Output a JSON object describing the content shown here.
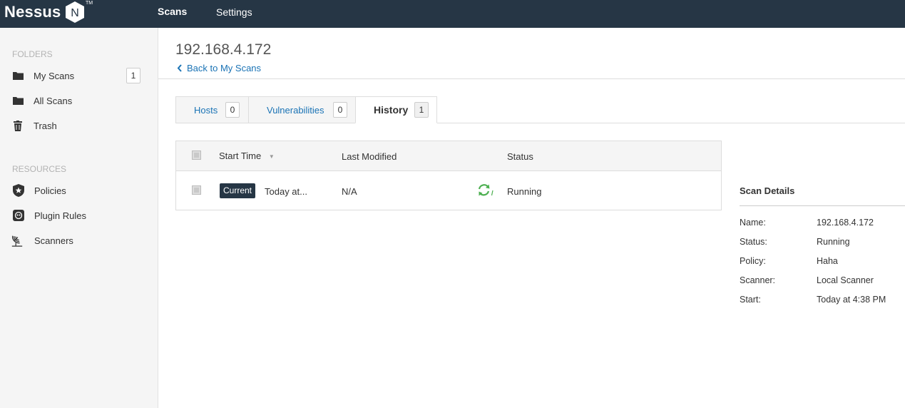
{
  "app": {
    "logo_text": "Nessus",
    "logo_badge_letter": "N",
    "trademark": "TM",
    "nav": [
      {
        "label": "Scans",
        "active": true
      },
      {
        "label": "Settings",
        "active": false
      }
    ]
  },
  "sidebar": {
    "folders_title": "FOLDERS",
    "folders": [
      {
        "label": "My Scans",
        "icon": "folder-icon",
        "count": "1"
      },
      {
        "label": "All Scans",
        "icon": "folder-icon"
      },
      {
        "label": "Trash",
        "icon": "trash-icon"
      }
    ],
    "resources_title": "RESOURCES",
    "resources": [
      {
        "label": "Policies",
        "icon": "shield-star-icon"
      },
      {
        "label": "Plugin Rules",
        "icon": "plugin-rules-icon"
      },
      {
        "label": "Scanners",
        "icon": "satellite-dish-icon"
      }
    ]
  },
  "page": {
    "title": "192.168.4.172",
    "back_link": "Back to My Scans"
  },
  "tabs": [
    {
      "label": "Hosts",
      "count": "0",
      "active": false
    },
    {
      "label": "Vulnerabilities",
      "count": "0",
      "active": false
    },
    {
      "label": "History",
      "count": "1",
      "active": true
    }
  ],
  "history_table": {
    "columns": [
      "Start Time",
      "Last Modified",
      "Status"
    ],
    "rows": [
      {
        "badge": "Current",
        "start_time": "Today at...",
        "last_modified": "N/A",
        "status": "Running"
      }
    ]
  },
  "scan_details": {
    "title": "Scan Details",
    "items": [
      {
        "key": "Name:",
        "value": "192.168.4.172"
      },
      {
        "key": "Status:",
        "value": "Running"
      },
      {
        "key": "Policy:",
        "value": "Haha"
      },
      {
        "key": "Scanner:",
        "value": "Local Scanner"
      },
      {
        "key": "Start:",
        "value": "Today at 4:38 PM"
      }
    ]
  },
  "colors": {
    "topbar": "#263645",
    "link": "#1a73b5",
    "running_spinner": "#4caf50"
  }
}
